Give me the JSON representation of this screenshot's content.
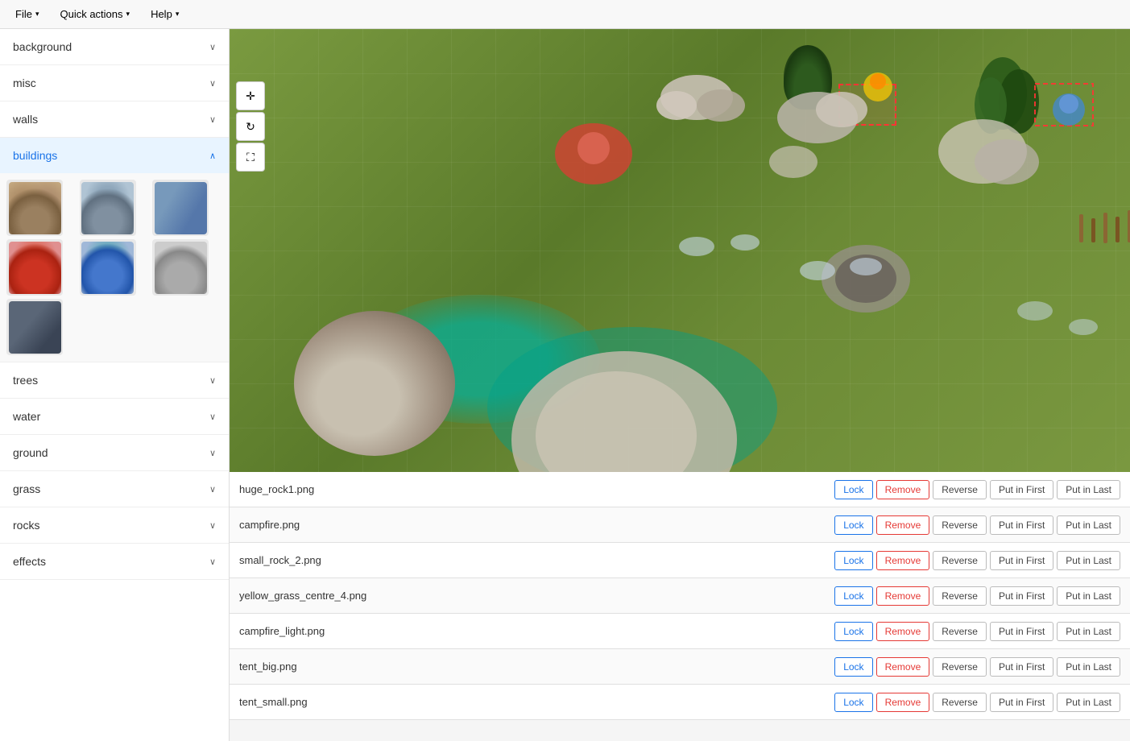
{
  "menubar": {
    "file_label": "File",
    "quick_actions_label": "Quick actions",
    "help_label": "Help"
  },
  "sidebar": {
    "items": [
      {
        "id": "background",
        "label": "background",
        "expanded": false
      },
      {
        "id": "misc",
        "label": "misc",
        "expanded": false
      },
      {
        "id": "walls",
        "label": "walls",
        "expanded": false
      },
      {
        "id": "buildings",
        "label": "buildings",
        "expanded": true
      },
      {
        "id": "trees",
        "label": "trees",
        "expanded": false
      },
      {
        "id": "water",
        "label": "water",
        "expanded": false
      },
      {
        "id": "ground",
        "label": "ground",
        "expanded": false
      },
      {
        "id": "grass",
        "label": "grass",
        "expanded": false
      },
      {
        "id": "rocks",
        "label": "rocks",
        "expanded": false
      },
      {
        "id": "effects",
        "label": "effects",
        "expanded": false
      }
    ],
    "buildings": {
      "items": [
        {
          "id": "bld1",
          "class": "bld-1"
        },
        {
          "id": "bld2",
          "class": "bld-2"
        },
        {
          "id": "bld3",
          "class": "bld-3"
        },
        {
          "id": "bld4",
          "class": "bld-4"
        },
        {
          "id": "bld5",
          "class": "bld-5"
        },
        {
          "id": "bld6",
          "class": "bld-6"
        },
        {
          "id": "bld7",
          "class": "bld-7"
        }
      ]
    }
  },
  "canvas": {
    "toolbar": {
      "move_icon": "✛",
      "rotate_icon": "↻",
      "expand_icon": "⛶"
    }
  },
  "list": {
    "rows": [
      {
        "filename": "huge_rock1.png"
      },
      {
        "filename": "campfire.png"
      },
      {
        "filename": "small_rock_2.png"
      },
      {
        "filename": "yellow_grass_centre_4.png"
      },
      {
        "filename": "campfire_light.png"
      },
      {
        "filename": "tent_big.png"
      },
      {
        "filename": "tent_small.png"
      }
    ],
    "btn_lock": "Lock",
    "btn_remove": "Remove",
    "btn_reverse": "Reverse",
    "btn_put_first": "Put in First",
    "btn_put_last": "Put in Last"
  }
}
